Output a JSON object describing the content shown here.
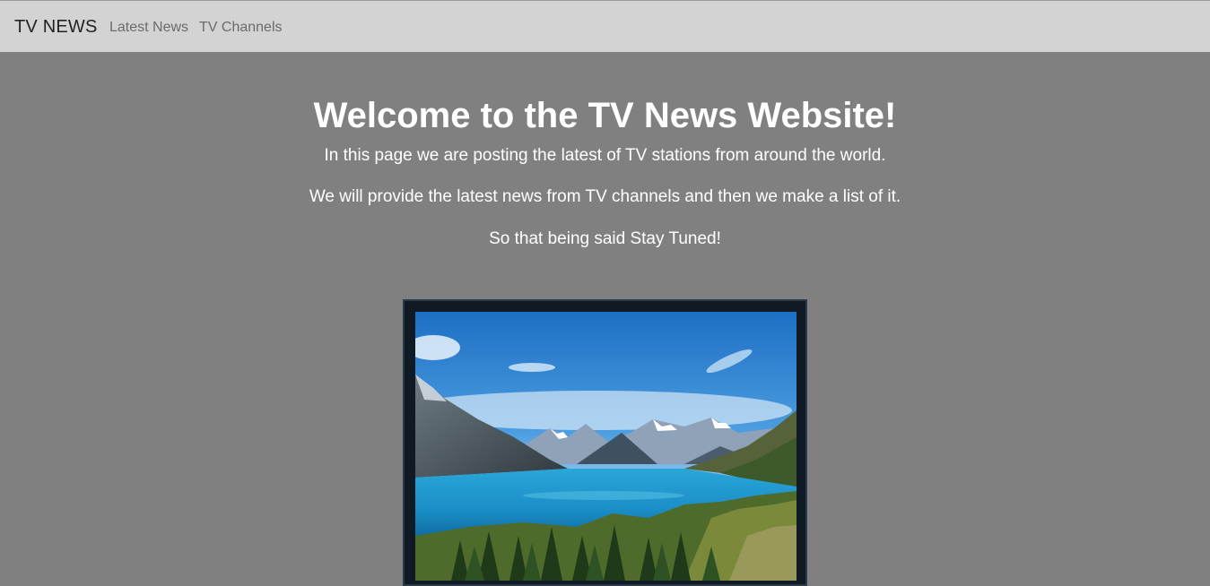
{
  "navbar": {
    "brand": "TV NEWS",
    "links": [
      {
        "label": "Latest News"
      },
      {
        "label": "TV Channels"
      }
    ]
  },
  "main": {
    "title": "Welcome to the TV News Website!",
    "paragraphs": [
      "In this page we are posting the latest of TV stations from around the world.",
      "We will provide the latest news from TV channels and then we make a list of it.",
      "So that being said Stay Tuned!"
    ]
  },
  "colors": {
    "navbar_bg": "#d3d3d3",
    "page_bg": "#808080",
    "text": "#ffffff"
  },
  "icons": {
    "tv_image": "tv-landscape-image"
  }
}
